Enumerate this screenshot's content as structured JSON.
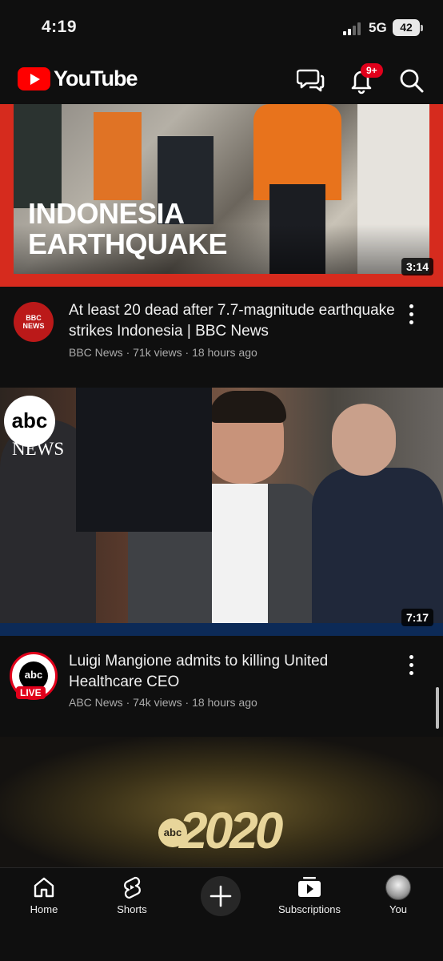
{
  "status_bar": {
    "time": "4:19",
    "network": "5G",
    "battery": "42"
  },
  "header": {
    "app_name": "YouTube",
    "notification_count": "9+"
  },
  "videos": [
    {
      "thumbnail_text_line1": "INDONESIA",
      "thumbnail_text_line2": "EARTHQUAKE",
      "duration": "3:14",
      "channel_avatar_text": "BBC NEWS",
      "title": "At least 20 dead after 7.7-magnitude earthquake strikes Indonesia | BBC News",
      "channel": "BBC News",
      "views": "71k views",
      "age": "18 hours ago"
    },
    {
      "thumbnail_logo_top": "abc",
      "thumbnail_logo_bottom": "NEWS",
      "duration": "7:17",
      "channel_avatar_text": "abc",
      "live_label": "LIVE",
      "title": "Luigi Mangione admits to killing United Healthcare CEO",
      "channel": "ABC News",
      "views": "74k views",
      "age": "18 hours ago"
    },
    {
      "thumbnail_logo_prefix": "abc",
      "thumbnail_logo": "2020"
    }
  ],
  "nav": {
    "home": "Home",
    "shorts": "Shorts",
    "subscriptions": "Subscriptions",
    "you": "You"
  },
  "colors": {
    "brand_red": "#ff0000",
    "background": "#0f0f0f",
    "badge": "#e1001b"
  }
}
